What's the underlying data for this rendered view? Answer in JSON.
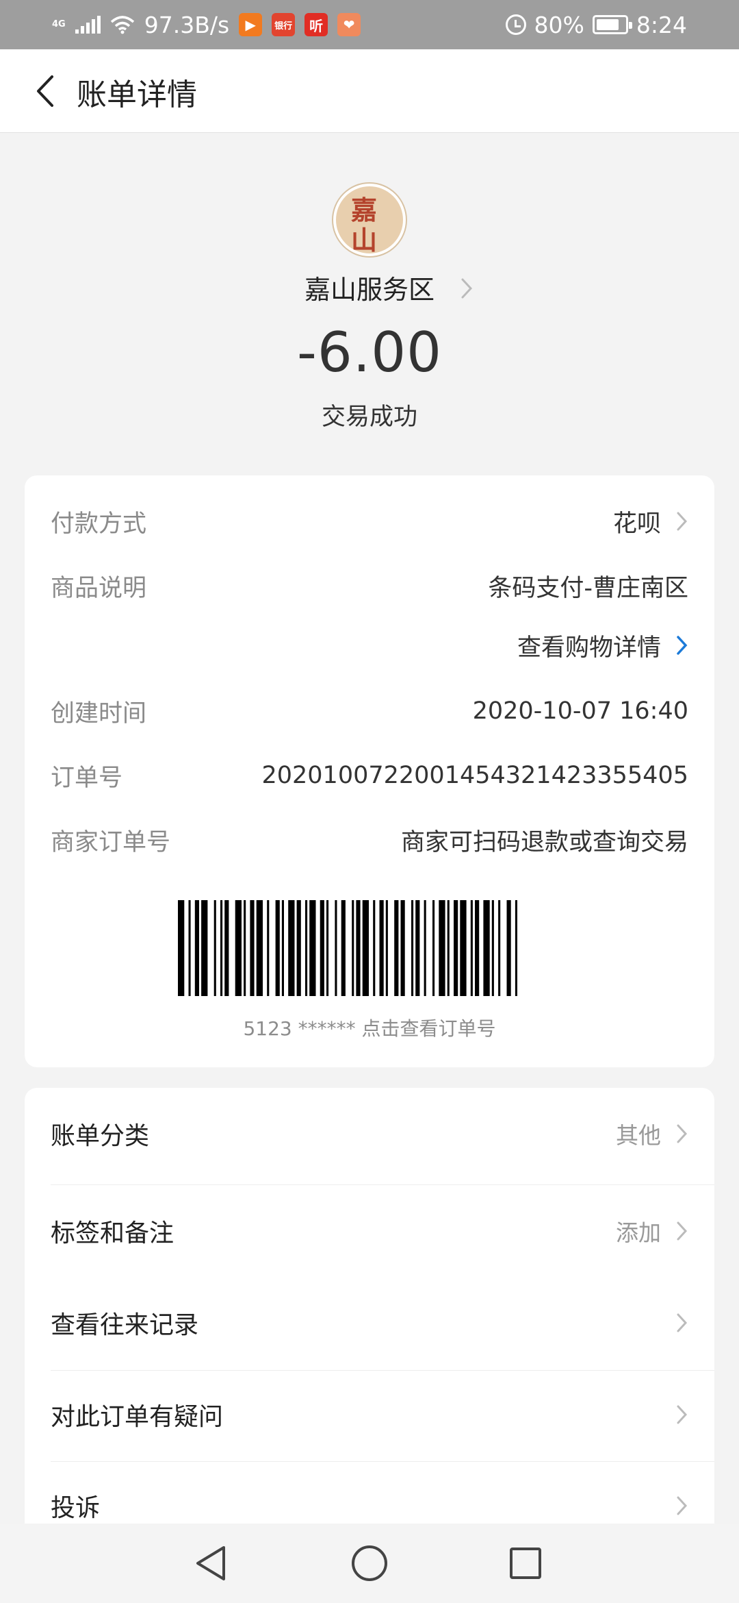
{
  "status_bar": {
    "network": "4G",
    "speed": "97.3B/s",
    "app_icons": [
      "video-app-icon",
      "bank-app-icon",
      "listen-app-icon",
      "health-app-icon"
    ],
    "app_icon_texts": [
      "▶",
      "银行",
      "听",
      "❤"
    ],
    "app_icon_colors": [
      "#f27a1f",
      "#e2442f",
      "#e12d24",
      "#f08a5d"
    ],
    "battery": "80%",
    "battery_level": 0.8,
    "time": "8:24"
  },
  "header": {
    "title": "账单详情"
  },
  "merchant": {
    "avatar_chars": [
      "嘉",
      "山"
    ],
    "name": "嘉山服务区",
    "amount": "-6.00",
    "status": "交易成功"
  },
  "details": {
    "payment_method_label": "付款方式",
    "payment_method_value": "花呗",
    "product_label": "商品说明",
    "product_value": "条码支付-曹庄南区",
    "shopping_link": "查看购物详情",
    "created_label": "创建时间",
    "created_value": "2020-10-07 16:40",
    "order_label": "订单号",
    "order_value": "2020100722001454321423355405",
    "merchant_order_label": "商家订单号",
    "merchant_order_value": "商家可扫码退款或查询交易",
    "barcode_caption": "5123 ****** 点击查看订单号"
  },
  "actions": {
    "category_label": "账单分类",
    "category_value": "其他",
    "tags_label": "标签和备注",
    "tags_value": "添加",
    "history_label": "查看往来记录",
    "question_label": "对此订单有疑问",
    "complaint_label": "投诉"
  },
  "colors": {
    "link": "#1c7ad8",
    "status_bar": "#9e9e9e",
    "background": "#f3f3f3"
  }
}
